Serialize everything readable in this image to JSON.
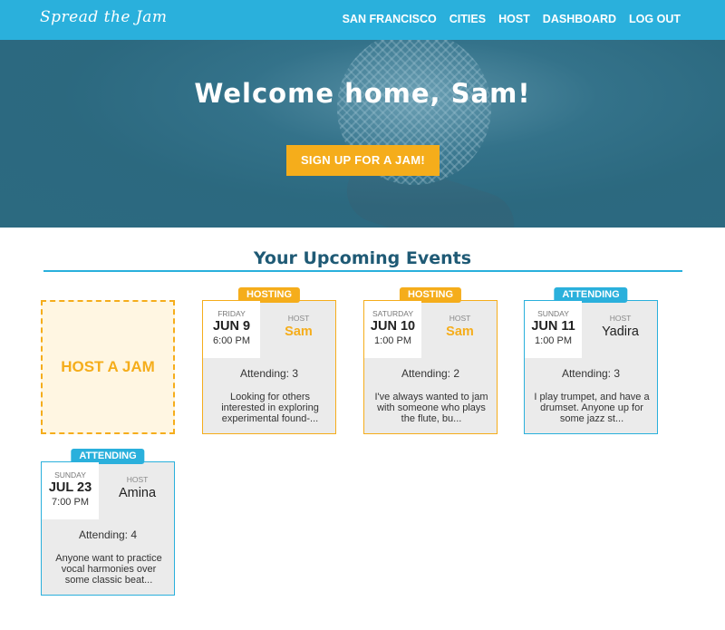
{
  "nav": {
    "brand": "Spread the Jam",
    "links": [
      "SAN FRANCISCO",
      "CITIES",
      "HOST",
      "DASHBOARD",
      "LOG OUT"
    ]
  },
  "hero": {
    "title": "Welcome home, Sam!",
    "cta": "SIGN UP FOR A JAM!"
  },
  "section": {
    "title": "Your Upcoming Events"
  },
  "host_card": {
    "label": "HOST A JAM"
  },
  "events": [
    {
      "badge": "HOSTING",
      "day": "FRIDAY",
      "date": "JUN 9",
      "time": "6:00 PM",
      "host_label": "HOST",
      "host": "Sam",
      "attending": "Attending: 3",
      "description": "Looking for others interested in exploring experimental found-..."
    },
    {
      "badge": "HOSTING",
      "day": "SATURDAY",
      "date": "JUN 10",
      "time": "1:00 PM",
      "host_label": "HOST",
      "host": "Sam",
      "attending": "Attending: 2",
      "description": "I've always wanted to jam with someone who plays the flute, bu..."
    },
    {
      "badge": "ATTENDING",
      "day": "SUNDAY",
      "date": "JUN 11",
      "time": "1:00 PM",
      "host_label": "HOST",
      "host": "Yadira",
      "attending": "Attending: 3",
      "description": "I play trumpet, and have a drumset. Anyone up for some jazz st..."
    },
    {
      "badge": "ATTENDING",
      "day": "SUNDAY",
      "date": "JUL 23",
      "time": "7:00 PM",
      "host_label": "HOST",
      "host": "Amina",
      "attending": "Attending: 4",
      "description": "Anyone want to practice vocal harmonies over some classic beat..."
    }
  ],
  "colors": {
    "primary": "#2ab0dc",
    "accent": "#f5ad1b",
    "heading": "#1f5a75",
    "hero": "#2f6f86"
  }
}
